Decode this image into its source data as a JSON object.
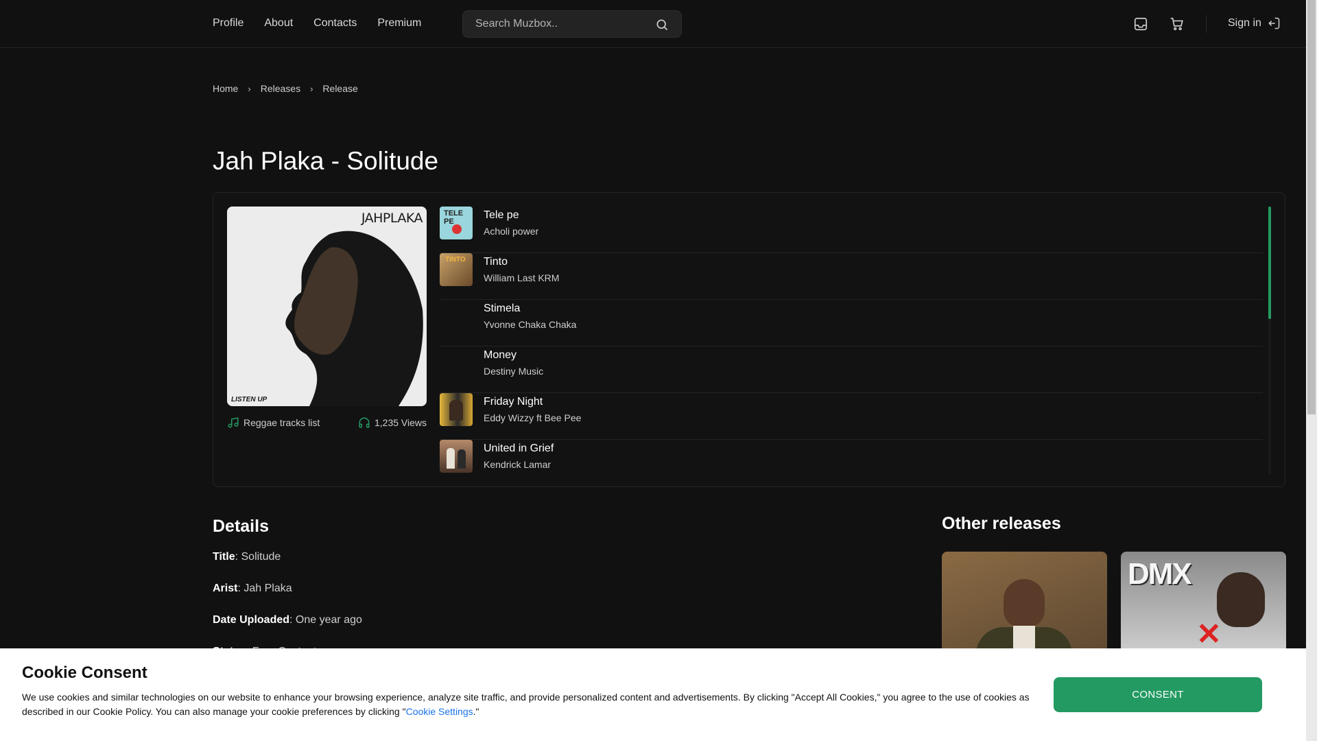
{
  "nav": {
    "links": [
      "Profile",
      "About",
      "Contacts",
      "Premium"
    ]
  },
  "search": {
    "placeholder": "Search Muzbox.."
  },
  "header": {
    "signin_label": "Sign in"
  },
  "breadcrumb": {
    "items": [
      "Home",
      "Releases",
      "Release"
    ]
  },
  "release": {
    "title": "Jah Plaka - Solitude",
    "cover_text_top": "JAHPLAKA",
    "cover_text_bottom": "LISTEN UP",
    "genre_label": "Reggae tracks list",
    "views_label": "1,235 Views"
  },
  "tracks": [
    {
      "title": "Tele pe",
      "artist": "Acholi power",
      "thumb_color": "#9ad6dd"
    },
    {
      "title": "Tinto",
      "artist": "William Last KRM",
      "thumb_color": "#a07a48"
    },
    {
      "title": "Stimela",
      "artist": "Yvonne Chaka Chaka",
      "thumb_color": ""
    },
    {
      "title": "Money",
      "artist": "Destiny Music",
      "thumb_color": ""
    },
    {
      "title": "Friday Night",
      "artist": "Eddy Wizzy ft Bee Pee",
      "thumb_color": "#caa23a"
    },
    {
      "title": "United in Grief",
      "artist": "Kendrick Lamar",
      "thumb_color": "#6b4a38"
    }
  ],
  "details": {
    "heading": "Details",
    "rows": [
      {
        "label": "Title",
        "value": "Solitude"
      },
      {
        "label": "Arist",
        "value": "Jah Plaka"
      },
      {
        "label": "Date Uploaded",
        "value": "One year ago"
      },
      {
        "label": "Status",
        "value": "Free Content"
      }
    ]
  },
  "other": {
    "heading": "Other releases",
    "cards": [
      {
        "subject": "man-in-olive-jacket"
      },
      {
        "subject": "dmx-the-definition-album",
        "text": "DMX"
      }
    ]
  },
  "cookie": {
    "title": "Cookie Consent",
    "text_before": "We use cookies and similar technologies on our website to enhance your browsing experience, analyze site traffic, and provide personalized content and advertisements. By clicking \"Accept All Cookies,\" you agree to the use of cookies as described in our Cookie Policy. You can also manage your cookie preferences by clicking \"",
    "link": "Cookie Settings",
    "text_after": ".\"",
    "button": "CONSENT"
  },
  "colors": {
    "accent": "#239a62",
    "background": "#111111",
    "link": "#1a73e8"
  }
}
